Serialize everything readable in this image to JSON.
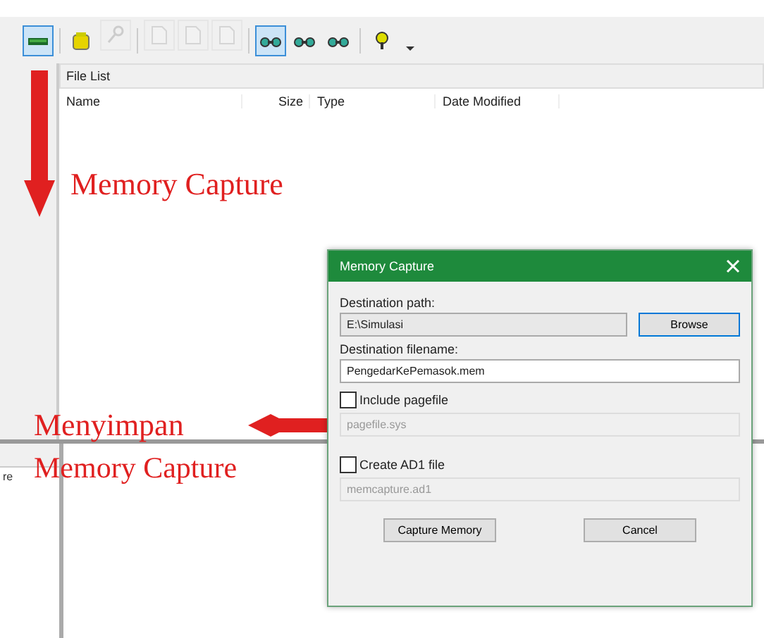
{
  "toolbar": {
    "buttons": [
      {
        "kind": "memory",
        "selected": true,
        "disabled": false
      },
      {
        "kind": "add",
        "selected": false,
        "disabled": false
      },
      {
        "kind": "key",
        "selected": false,
        "disabled": true
      },
      {
        "kind": "page",
        "selected": false,
        "disabled": true
      },
      {
        "kind": "page",
        "selected": false,
        "disabled": true
      },
      {
        "kind": "page",
        "selected": false,
        "disabled": true
      },
      {
        "kind": "glasses",
        "selected": true,
        "disabled": false
      },
      {
        "kind": "glasses",
        "selected": false,
        "disabled": false
      },
      {
        "kind": "glasses",
        "selected": false,
        "disabled": false
      },
      {
        "kind": "help",
        "selected": false,
        "disabled": false
      }
    ]
  },
  "file_list": {
    "title": "File List",
    "columns": [
      "Name",
      "Size",
      "Type",
      "Date Modified"
    ]
  },
  "lower_left_pane": {
    "text": "re"
  },
  "annotations": [
    "Memory Capture",
    "Menyimpan",
    "Memory Capture"
  ],
  "dialog": {
    "title": "Memory Capture",
    "path_label": "Destination path:",
    "path_value": "E:\\Simulasi",
    "browse": "Browse",
    "filename_label": "Destination filename:",
    "filename_value": "PengedarKePemasok.mem",
    "options": [
      {
        "label": "Include pagefile",
        "checked": false,
        "value": "pagefile.sys"
      },
      {
        "label": "Create AD1 file",
        "checked": false,
        "value": "memcapture.ad1"
      }
    ],
    "buttons": [
      "Capture Memory",
      "Cancel"
    ]
  }
}
